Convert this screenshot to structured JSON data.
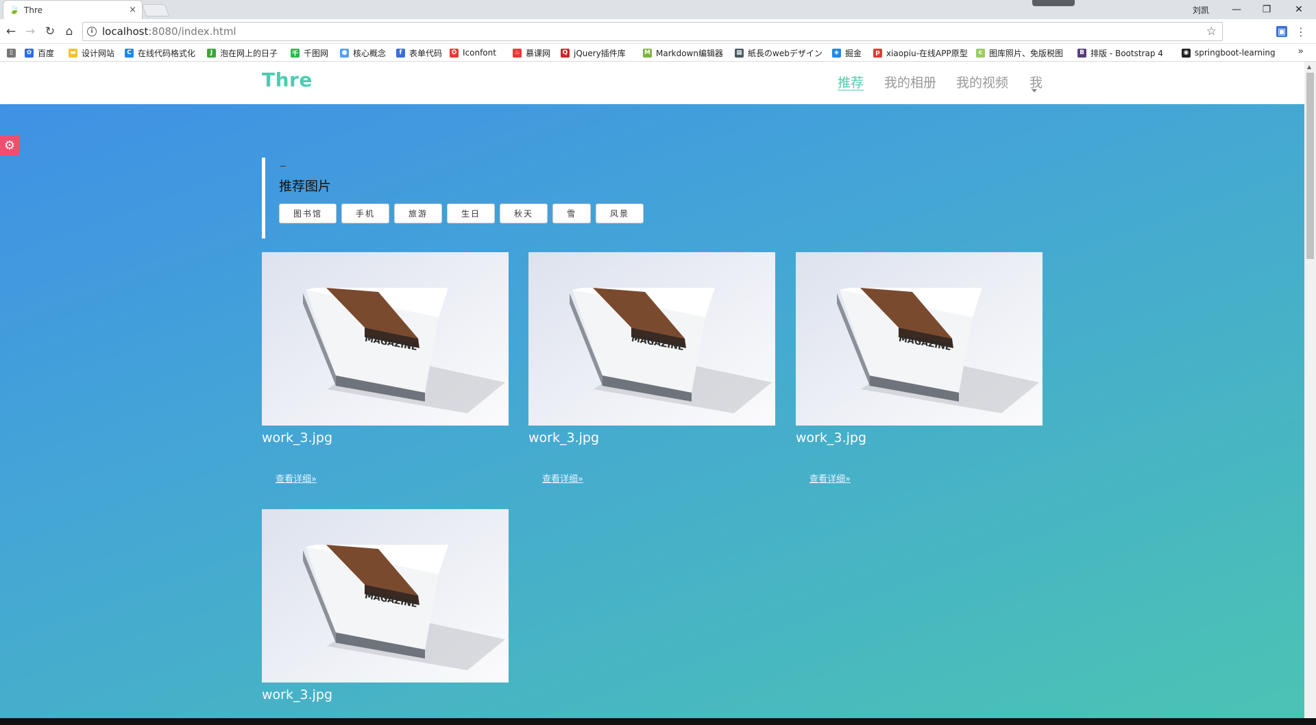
{
  "browser": {
    "tab_title": "Thre",
    "tab_close": "×",
    "user_name": "刘凯",
    "url_host": "localhost",
    "url_rest": ":8080/index.html",
    "bookmarks": [
      {
        "label": "",
        "icon": "page",
        "color": "#777"
      },
      {
        "label": "百度",
        "icon": "paw",
        "color": "#2d6ee0"
      },
      {
        "label": "设计网站",
        "icon": "folder",
        "color": "#f4c430"
      },
      {
        "label": "在线代码格式化",
        "icon": "C",
        "color": "#1e88e5"
      },
      {
        "label": "泡在网上的日子",
        "icon": "J",
        "color": "#3aa639"
      },
      {
        "label": "千图网",
        "icon": "千",
        "color": "#2db84d"
      },
      {
        "label": "核心概念",
        "icon": "●",
        "color": "#4aa3ff"
      },
      {
        "label": "表单代码",
        "icon": "f",
        "color": "#3b6fd8"
      },
      {
        "label": "Iconfont",
        "icon": "✪",
        "color": "#e53935"
      },
      {
        "label": "慕课网",
        "icon": "♨",
        "color": "#e53935"
      },
      {
        "label": "jQuery插件库",
        "icon": "Q",
        "color": "#c62828"
      },
      {
        "label": "Markdown编辑器",
        "icon": "M",
        "color": "#7cb342"
      },
      {
        "label": "紙長のwebデザイン",
        "icon": "▦",
        "color": "#455a64"
      },
      {
        "label": "掘金",
        "icon": "◈",
        "color": "#1e88e5"
      },
      {
        "label": "xiaopiu-在线APP原型",
        "icon": "p",
        "color": "#e53935"
      },
      {
        "label": "图库照片、免版税图",
        "icon": "c",
        "color": "#9ccc65"
      },
      {
        "label": "排版 - Bootstrap 4",
        "icon": "B",
        "color": "#563d7c"
      },
      {
        "label": "springboot-learning",
        "icon": "◉",
        "color": "#222"
      }
    ]
  },
  "site": {
    "logo": "Thre",
    "nav": [
      "推荐",
      "我的相册",
      "我的视频",
      "我"
    ]
  },
  "section": {
    "title": "推荐图片",
    "tags": [
      "图书馆",
      "手机",
      "旅游",
      "生日",
      "秋天",
      "雪",
      "风景"
    ]
  },
  "cards": [
    {
      "name": "work_3.jpg",
      "link": "查看详细»",
      "image_text": "MAGAZINE"
    },
    {
      "name": "work_3.jpg",
      "link": "查看详细»",
      "image_text": "MAGAZINE"
    },
    {
      "name": "work_3.jpg",
      "link": "查看详细»",
      "image_text": "MAGAZINE"
    },
    {
      "name": "work_3.jpg",
      "link": "",
      "image_text": "MAGAZINE"
    }
  ]
}
